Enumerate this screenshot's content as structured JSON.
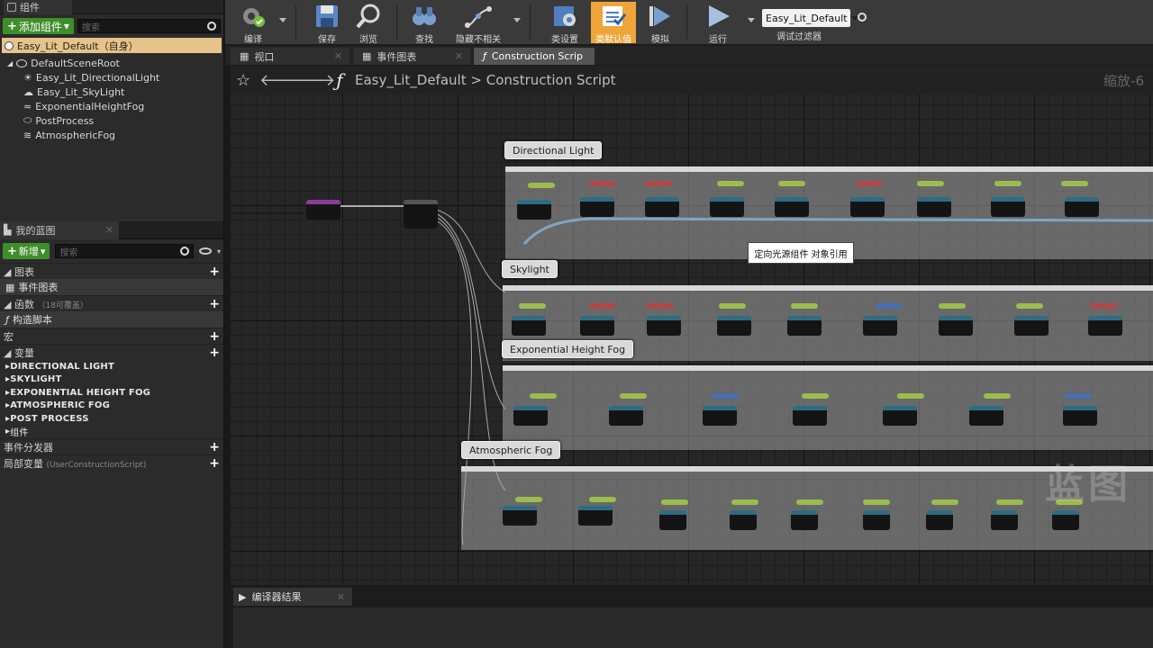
{
  "components_panel": {
    "tab_label": "组件",
    "add_button": "添加组件",
    "search_placeholder": "搜索",
    "self_item": "Easy_Lit_Default（自身）",
    "tree": [
      "DefaultSceneRoot",
      "Easy_Lit_DirectionalLight",
      "Easy_Lit_SkyLight",
      "ExponentialHeightFog",
      "PostProcess",
      "AtmosphericFog"
    ]
  },
  "my_blueprint": {
    "tab_label": "我的蓝图",
    "new_button": "新增",
    "search_placeholder": "搜索",
    "graphs_label": "图表",
    "event_graph": "事件图表",
    "functions_label": "函数",
    "functions_sub": "（18可覆盖）",
    "construction_script": "构造脚本",
    "macros_label": "宏",
    "variables_label": "变量",
    "variables": [
      "DIRECTIONAL LIGHT",
      "SKYLIGHT",
      "EXPONENTIAL HEIGHT FOG",
      "ATMOSPHERIC FOG",
      "POST PROCESS",
      "组件"
    ],
    "dispatchers_label": "事件分发器",
    "local_vars_label": "局部变量",
    "local_vars_sub": "(UserConstructionScript)"
  },
  "toolbar": {
    "compile": "编译",
    "save": "保存",
    "browse": "浏览",
    "find": "查找",
    "hide_unrelated": "隐藏不相关",
    "class_settings": "类设置",
    "class_defaults": "类默认值",
    "simulate": "模拟",
    "play": "运行",
    "debug_object": "Easy_Lit_Default",
    "debug_filter": "调试过滤器",
    "accent_color": "#f0a53a"
  },
  "doc_tabs": [
    "视口",
    "事件图表",
    "Construction Scrip"
  ],
  "graph": {
    "breadcrumb_root": "Easy_Lit_Default",
    "breadcrumb_sep": ">",
    "breadcrumb_leaf": "Construction Script",
    "zoom_label": "缩放-6",
    "comments": [
      "Directional Light",
      "Skylight",
      "Exponential Height Fog",
      "Atmospheric Fog"
    ],
    "tooltip": "定向光源组件 对象引用"
  },
  "compiler_results": {
    "tab_label": "编译器结果"
  },
  "watermark_logo": "蓝图"
}
